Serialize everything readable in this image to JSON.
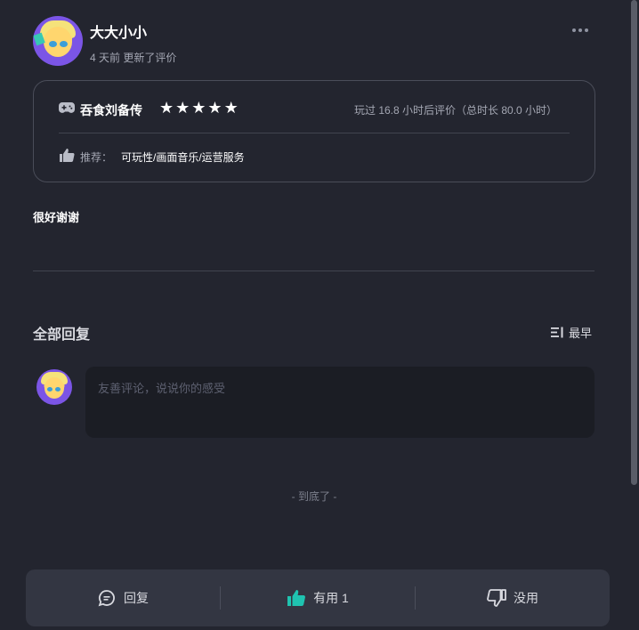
{
  "review": {
    "author": "大大小小",
    "meta": "4 天前 更新了评价",
    "game_name": "吞食刘备传",
    "stars": [
      "★",
      "★",
      "★",
      "★",
      "★"
    ],
    "playtime": "玩过 16.8 小时后评价（总时长 80.0 小时）",
    "recommend_label": "推荐：",
    "recommend_tags": "可玩性/画面音乐/运营服务",
    "text": "很好谢谢"
  },
  "replies": {
    "title": "全部回复",
    "sort_label": "最早",
    "comment_placeholder": "友善评论，说说你的感受",
    "end_text": "- 到底了 -"
  },
  "actions": {
    "reply_label": "回复",
    "useful_label": "有用 1",
    "useless_label": "没用"
  },
  "colors": {
    "background": "#23252f",
    "accent_teal": "#1fc3b0",
    "card_border": "#4a4d59"
  },
  "icons": {
    "game": "gamepad-icon",
    "recommend": "thumbs-up-icon",
    "sort": "sort-list-icon",
    "reply": "chat-bubble-icon",
    "useful": "thumbs-up-icon",
    "useless": "thumbs-down-icon",
    "more": "more-dots-icon"
  }
}
